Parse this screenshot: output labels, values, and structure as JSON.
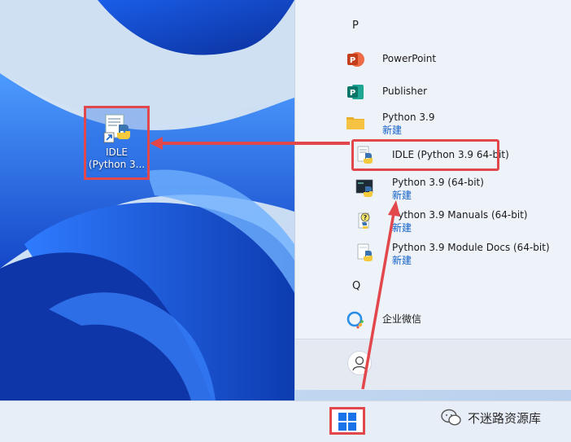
{
  "desktop": {
    "shortcut": {
      "line1": "IDLE",
      "line2": "(Python 3..."
    }
  },
  "start_menu": {
    "sections": [
      {
        "letter": "P"
      },
      {
        "letter": "Q"
      }
    ],
    "items": [
      {
        "name": "PowerPoint",
        "sub": ""
      },
      {
        "name": "Publisher",
        "sub": ""
      },
      {
        "name": "Python 3.9",
        "sub": "新建"
      },
      {
        "name": "IDLE (Python 3.9 64-bit)",
        "sub": ""
      },
      {
        "name": "Python 3.9 (64-bit)",
        "sub": "新建"
      },
      {
        "name": "Python 3.9 Manuals (64-bit)",
        "sub": "新建"
      },
      {
        "name": "Python 3.9 Module Docs (64-bit)",
        "sub": "新建"
      },
      {
        "name": "企业微信",
        "sub": ""
      }
    ]
  },
  "taskbar": {
    "watermark": "不迷路资源库"
  },
  "colors": {
    "highlight": "#e2474b",
    "accent_text": "#1461c9",
    "powerpoint": "#c43e1c",
    "publisher": "#077568",
    "folder": "#f5c242"
  }
}
